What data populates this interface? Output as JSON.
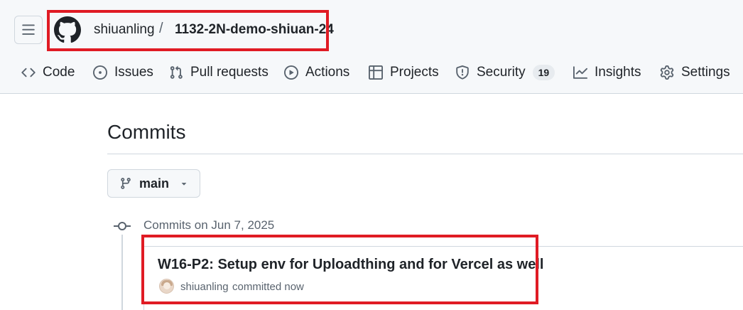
{
  "header": {
    "menu_icon": "hamburger-icon",
    "logo_icon": "github-mark-icon",
    "owner": "shiuanling",
    "separator": "/",
    "repo": "1132-2N-demo-shiuan-24"
  },
  "tabs": [
    {
      "label": "Code",
      "icon": "code-icon"
    },
    {
      "label": "Issues",
      "icon": "issue-opened-icon"
    },
    {
      "label": "Pull requests",
      "icon": "git-pull-request-icon"
    },
    {
      "label": "Actions",
      "icon": "play-icon"
    },
    {
      "label": "Projects",
      "icon": "table-icon"
    },
    {
      "label": "Security",
      "icon": "shield-icon",
      "counter": "19"
    },
    {
      "label": "Insights",
      "icon": "graph-icon"
    },
    {
      "label": "Settings",
      "icon": "gear-icon"
    }
  ],
  "page": {
    "title": "Commits"
  },
  "branch": {
    "label": "main",
    "icon": "git-branch-icon"
  },
  "commit_group": {
    "date_heading": "Commits on Jun 7, 2025",
    "commits": [
      {
        "title": "W16-P2: Setup env for Uploadthing and for Vercel as well",
        "author": "shiuanling",
        "meta": "committed now"
      }
    ]
  },
  "colors": {
    "highlight": "#e01b24",
    "muted_text": "#59636e",
    "border": "#d0d7de",
    "header_bg": "#f6f8fa"
  }
}
